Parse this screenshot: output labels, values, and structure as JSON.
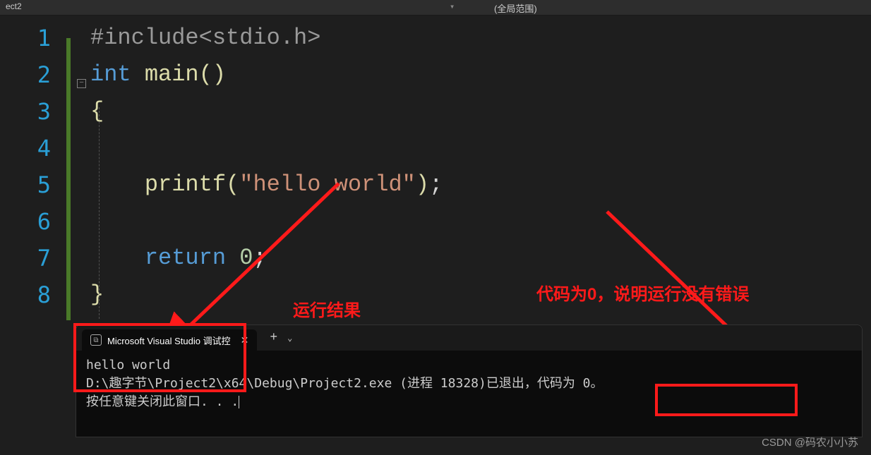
{
  "topbar": {
    "tab_label": "ect2",
    "scope_label": "(全局范围)"
  },
  "editor": {
    "line_numbers": [
      "1",
      "2",
      "3",
      "4",
      "5",
      "6",
      "7",
      "8"
    ],
    "code": {
      "l1_include": "#include",
      "l1_header": "<stdio.h>",
      "l2_type": "int",
      "l2_func": "main",
      "l2_parens": "()",
      "l3_brace": "{",
      "l5_func": "printf",
      "l5_open": "(",
      "l5_str": "\"hello world\"",
      "l5_close": ")",
      "l5_semi": ";",
      "l7_return": "return",
      "l7_zero": "0",
      "l7_semi": ";",
      "l8_brace": "}"
    }
  },
  "annotations": {
    "result_label": "运行结果",
    "exit_code_label": "代码为0，说明运行没有错误"
  },
  "terminal": {
    "tab_title": "Microsoft Visual Studio 调试控",
    "output_line": "hello world",
    "path_line": "D:\\趣字节\\Project2\\x64\\Debug\\Project2.exe (进程 18328)已退出，代码为 0。",
    "press_key_line": "按任意键关闭此窗口. . ."
  },
  "watermark": "CSDN @码农小小苏"
}
